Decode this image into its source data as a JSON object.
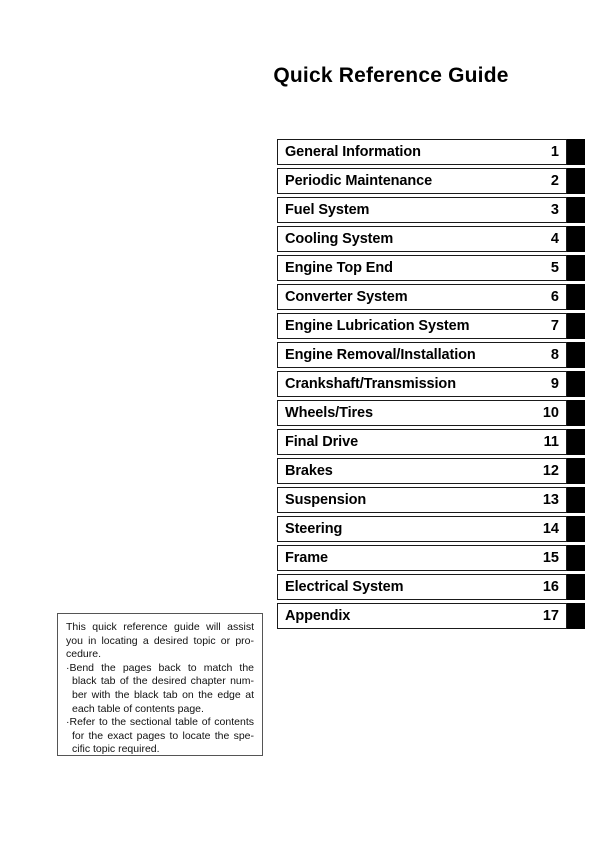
{
  "document": {
    "title": "Quick Reference Guide"
  },
  "chapters": [
    {
      "name": "General Information",
      "number": "1"
    },
    {
      "name": "Periodic Maintenance",
      "number": "2"
    },
    {
      "name": "Fuel System",
      "number": "3"
    },
    {
      "name": "Cooling System",
      "number": "4"
    },
    {
      "name": "Engine Top End",
      "number": "5"
    },
    {
      "name": "Converter System",
      "number": "6"
    },
    {
      "name": "Engine Lubrication System",
      "number": "7"
    },
    {
      "name": "Engine Removal/Installation",
      "number": "8"
    },
    {
      "name": "Crankshaft/Transmission",
      "number": "9"
    },
    {
      "name": "Wheels/Tires",
      "number": "10"
    },
    {
      "name": "Final Drive",
      "number": "11"
    },
    {
      "name": "Brakes",
      "number": "12"
    },
    {
      "name": "Suspension",
      "number": "13"
    },
    {
      "name": "Steering",
      "number": "14"
    },
    {
      "name": "Frame",
      "number": "15"
    },
    {
      "name": "Electrical System",
      "number": "16"
    },
    {
      "name": "Appendix",
      "number": "17"
    }
  ],
  "note": {
    "intro": "This quick reference guide will assist you in locating a desired topic or pro-cedure.",
    "bullets": [
      "Bend the pages back to match the black tab of the desired chapter num-ber with the black tab on the edge at each table of contents page.",
      "Refer to the sectional table of contents for the exact pages to locate the spe-cific topic required."
    ],
    "bullet_marker": "·"
  },
  "colors": {
    "page_background": "#ffffff",
    "text": "#000000",
    "tab_black": "#000000",
    "box_border": "#1a1a1a",
    "note_border": "#555555"
  }
}
